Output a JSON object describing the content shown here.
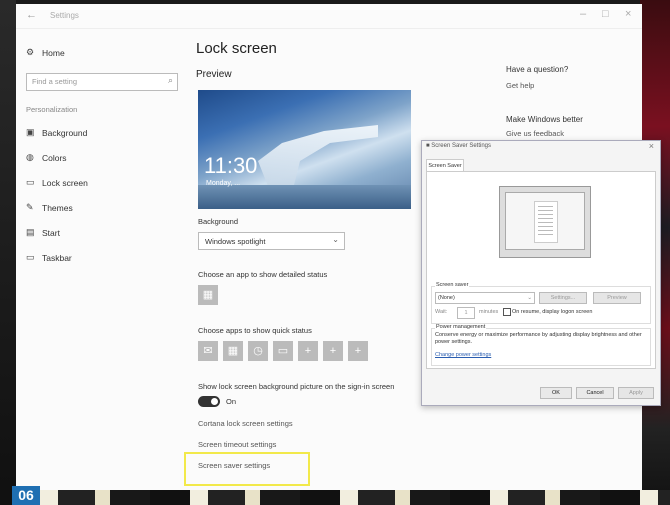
{
  "window": {
    "back_icon": "back-arrow-icon",
    "title": "Settings",
    "controls": [
      "–",
      "□",
      "×"
    ]
  },
  "sidebar": {
    "home_label": "Home",
    "search_placeholder": "Find a setting",
    "section_label": "Personalization",
    "items": [
      {
        "label": "Background",
        "icon": "background-icon"
      },
      {
        "label": "Colors",
        "icon": "colors-icon"
      },
      {
        "label": "Lock screen",
        "icon": "lock-screen-icon"
      },
      {
        "label": "Themes",
        "icon": "themes-icon"
      },
      {
        "label": "Start",
        "icon": "start-icon"
      },
      {
        "label": "Taskbar",
        "icon": "taskbar-icon"
      }
    ]
  },
  "main": {
    "title": "Lock screen",
    "preview_heading": "Preview",
    "preview_time": "11:30",
    "preview_date": "Monday, ...",
    "background_label": "Background",
    "background_value": "Windows spotlight",
    "detailed_status_label": "Choose an app to show detailed status",
    "quick_status_label": "Choose apps to show quick status",
    "quick_status_tiles": [
      "✉",
      "▦",
      "◷",
      "▭",
      "+",
      "+",
      "+"
    ],
    "signin_label": "Show lock screen background picture on the sign-in screen",
    "signin_state": "On",
    "cortana_link": "Cortana lock screen settings",
    "timeout_link": "Screen timeout settings",
    "screensaver_link": "Screen saver settings"
  },
  "right_panel": {
    "question_heading": "Have a question?",
    "get_help": "Get help",
    "better_heading": "Make Windows better",
    "feedback": "Give us feedback"
  },
  "screensaver_dialog": {
    "title": "Screen Saver Settings",
    "tab": "Screen Saver",
    "group_label": "Screen saver",
    "selected": "(None)",
    "settings_btn": "Settings...",
    "preview_btn": "Preview",
    "wait_label": "Wait:",
    "wait_value": "1",
    "minutes_label": "minutes",
    "resume_label": "On resume, display logon screen",
    "power_label": "Power management",
    "power_text": "Conserve energy or maximize performance by adjusting display brightness and other power settings.",
    "power_link": "Change power settings",
    "ok": "OK",
    "cancel": "Cancel",
    "apply": "Apply"
  },
  "badge": "06"
}
